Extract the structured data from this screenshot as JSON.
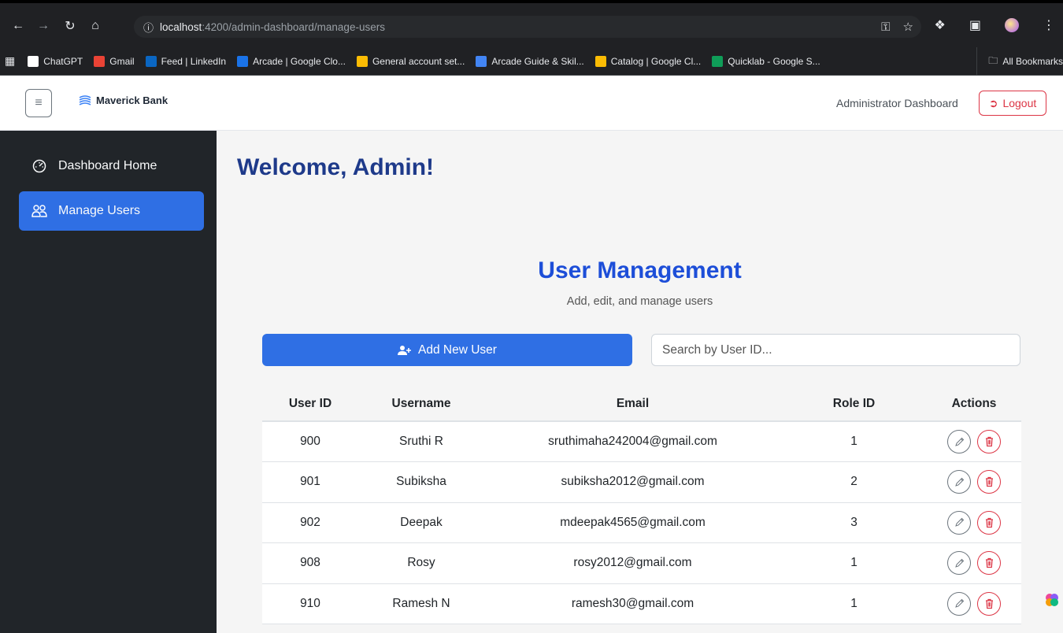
{
  "browser": {
    "url_host": "localhost",
    "url_path": ":4200/admin-dashboard/manage-users",
    "bookmarks": [
      {
        "label": "ChatGPT",
        "icon": "chatgpt-icon",
        "color": "#ffffff"
      },
      {
        "label": "Gmail",
        "icon": "gmail-icon",
        "color": "#ea4335"
      },
      {
        "label": "Feed | LinkedIn",
        "icon": "linkedin-icon",
        "color": "#0a66c2"
      },
      {
        "label": "Arcade | Google Clo...",
        "icon": "arcade-icon",
        "color": "#1a73e8"
      },
      {
        "label": "General account set...",
        "icon": "google-cloud-icon",
        "color": "#fbbc04"
      },
      {
        "label": "Arcade Guide & Skil...",
        "icon": "docs-icon",
        "color": "#4285f4"
      },
      {
        "label": "Catalog | Google Cl...",
        "icon": "google-cloud-icon",
        "color": "#fbbc04"
      },
      {
        "label": "Quicklab - Google S...",
        "icon": "sheets-icon",
        "color": "#0f9d58"
      }
    ],
    "all_bookmarks": "All Bookmarks"
  },
  "header": {
    "brand": "Maverick Bank",
    "admin_label": "Administrator Dashboard",
    "logout": "Logout"
  },
  "sidebar": {
    "items": [
      {
        "label": "Dashboard Home",
        "icon": "speedometer-icon",
        "active": false
      },
      {
        "label": "Manage Users",
        "icon": "people-icon",
        "active": true
      }
    ]
  },
  "main": {
    "welcome": "Welcome, Admin!",
    "title": "User Management",
    "subtitle": "Add, edit, and manage users",
    "add_button": "Add New User",
    "search_placeholder": "Search by User ID..."
  },
  "table": {
    "headers": [
      "User ID",
      "Username",
      "Email",
      "Role ID",
      "Actions"
    ],
    "rows": [
      {
        "id": "900",
        "username": "Sruthi R",
        "email": "sruthimaha242004@gmail.com",
        "role": "1"
      },
      {
        "id": "901",
        "username": "Subiksha",
        "email": "subiksha2012@gmail.com",
        "role": "2"
      },
      {
        "id": "902",
        "username": "Deepak",
        "email": "mdeepak4565@gmail.com",
        "role": "3"
      },
      {
        "id": "908",
        "username": "Rosy",
        "email": "rosy2012@gmail.com",
        "role": "1"
      },
      {
        "id": "910",
        "username": "Ramesh N",
        "email": "ramesh30@gmail.com",
        "role": "1"
      }
    ]
  },
  "colors": {
    "primary": "#2f6fe4",
    "danger": "#dc3545",
    "sidebar_bg": "#212529",
    "title_blue": "#1d4ed8"
  }
}
